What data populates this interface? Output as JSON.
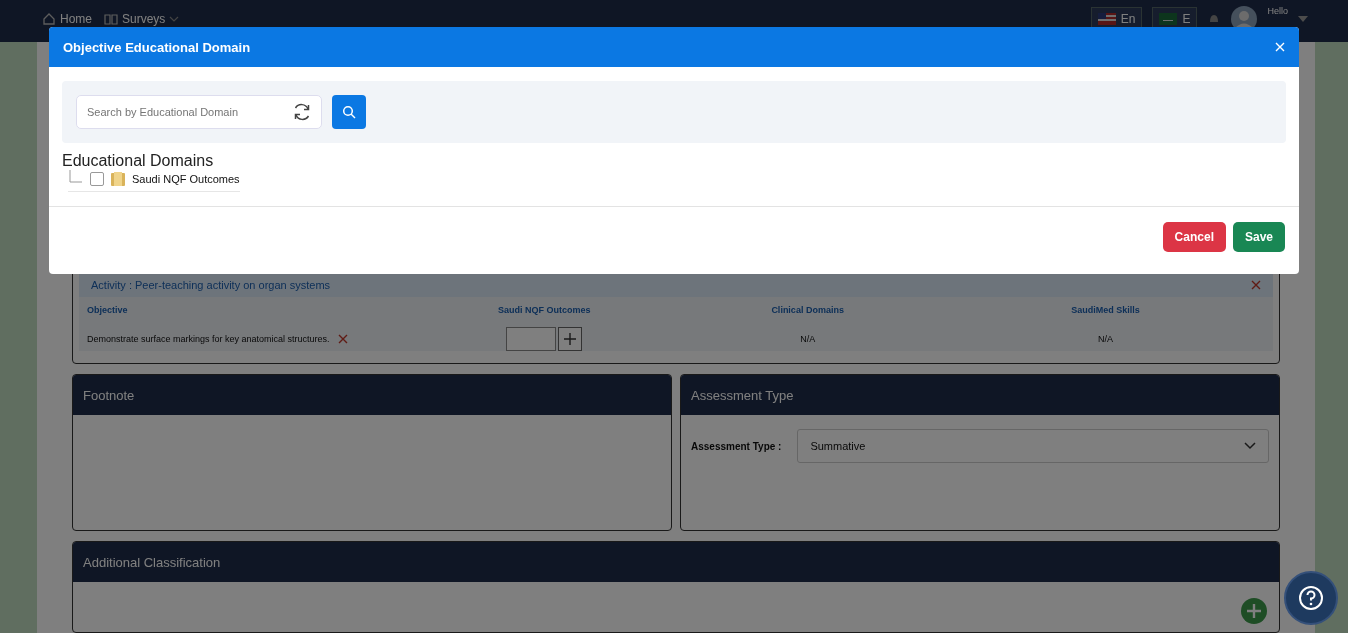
{
  "topbar": {
    "nav": [
      {
        "label": "Home",
        "kind": "home"
      },
      {
        "label": "Surveys",
        "kind": "surveys"
      }
    ],
    "languages": [
      {
        "label": "En",
        "kind": "us"
      },
      {
        "label": "E",
        "kind": "sa"
      }
    ],
    "greeting": "Hello"
  },
  "page": {
    "activity": {
      "title": "Activity : Peer-teaching activity on organ systems",
      "columns": [
        "Objective",
        "Saudi NQF Outcomes",
        "Clinical Domains",
        "SaudiMed Skills"
      ],
      "rows": [
        {
          "objective": "Demonstrate surface markings for key anatomical structures.",
          "clinical": "N/A",
          "skills": "N/A"
        }
      ]
    },
    "footnote": {
      "title": "Footnote"
    },
    "assessment": {
      "title": "Assessment Type",
      "label": "Assessment Type :",
      "value": "Summative"
    },
    "additional": {
      "title": "Additional Classification"
    }
  },
  "modal": {
    "title": "Objective Educational Domain",
    "search": {
      "placeholder": "Search by Educational Domain"
    },
    "tree_title": "Educational Domains",
    "tree": [
      {
        "label": "Saudi NQF Outcomes",
        "checked": false
      }
    ],
    "buttons": [
      {
        "label": "Cancel",
        "kind": "danger"
      },
      {
        "label": "Save",
        "kind": "success"
      }
    ]
  }
}
